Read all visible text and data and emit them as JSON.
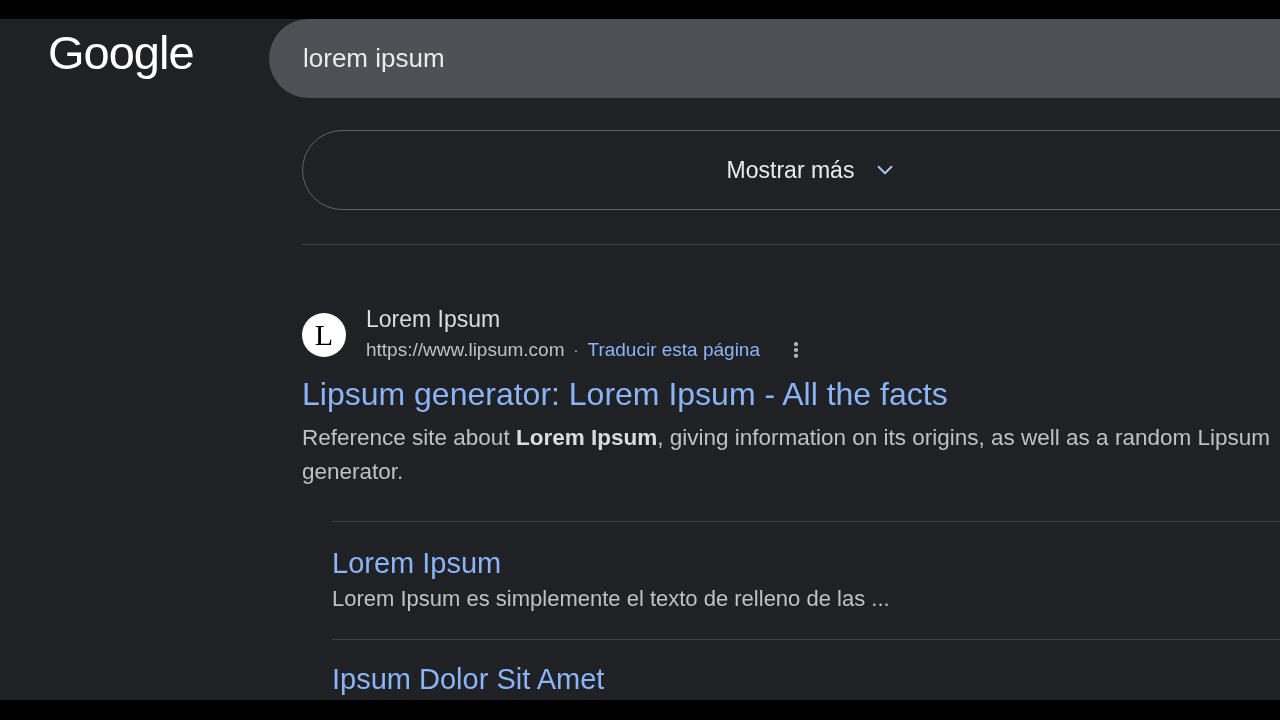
{
  "header": {
    "logo": "Google",
    "search": {
      "value": "lorem ipsum"
    }
  },
  "show_more": {
    "label": "Mostrar más",
    "expanded": false
  },
  "result": {
    "favicon_letter": "L",
    "site_name": "Lorem Ipsum",
    "url": "https://www.lipsum.com",
    "separator": "·",
    "translate_link": "Traducir esta página",
    "title": "Lipsum generator: Lorem Ipsum - All the facts",
    "snippet": "Reference site about **Lorem Ipsum**, giving information on its origins, as well as a random Lipsum generator.",
    "sitelinks": [
      {
        "title": "Lorem Ipsum",
        "description": "Lorem Ipsum es simplemente el texto de relleno de las ..."
      },
      {
        "title": "Ipsum Dolor Sit Amet"
      }
    ]
  }
}
